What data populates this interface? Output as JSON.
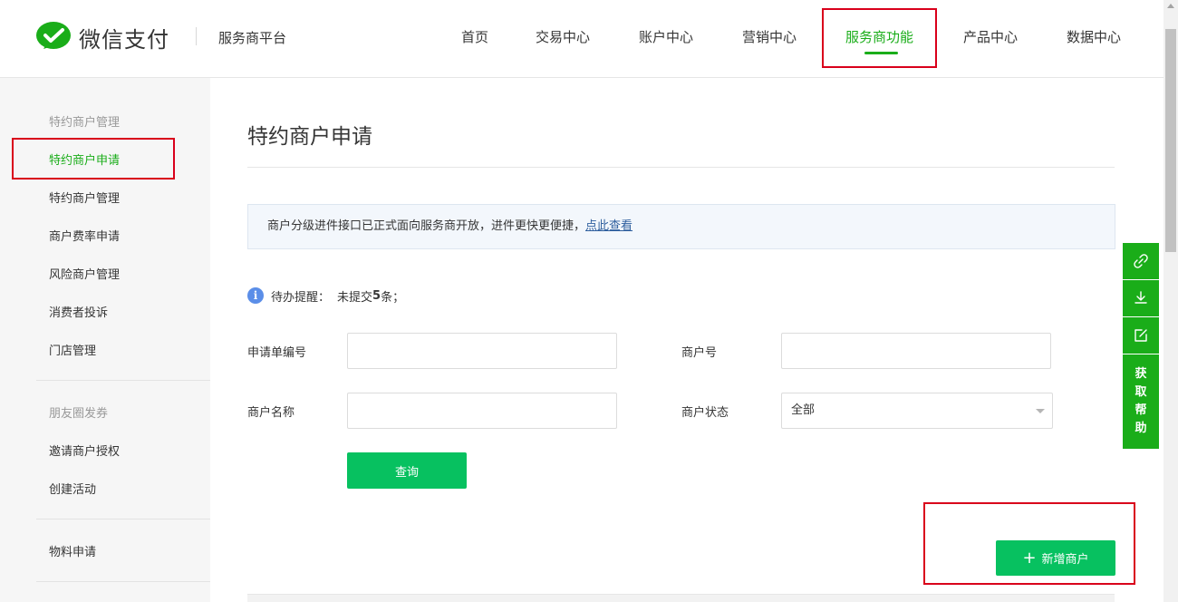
{
  "header": {
    "logo_text": "微信支付",
    "platform": "服务商平台",
    "nav": [
      {
        "label": "首页"
      },
      {
        "label": "交易中心"
      },
      {
        "label": "账户中心"
      },
      {
        "label": "营销中心"
      },
      {
        "label": "服务商功能",
        "active": true
      },
      {
        "label": "产品中心"
      },
      {
        "label": "数据中心"
      }
    ],
    "accent_color": "#1aad19"
  },
  "sidebar": {
    "groups": [
      {
        "title": "特约商户管理",
        "items": [
          "特约商户申请",
          "特约商户管理",
          "商户费率申请",
          "风险商户管理",
          "消费者投诉",
          "门店管理"
        ],
        "active_item": "特约商户申请"
      },
      {
        "title": "朋友圈发券",
        "items": [
          "邀请商户授权",
          "创建活动"
        ]
      },
      {
        "title": "",
        "items": [
          "物料申请"
        ]
      }
    ]
  },
  "main": {
    "title": "特约商户申请",
    "notice": {
      "text": "商户分级进件接口已正式面向服务商开放，进件更快更便捷，",
      "link": "点此查看"
    },
    "reminder": {
      "label": "待办提醒：",
      "prefix": "未提交",
      "count": "5",
      "suffix": "条；"
    },
    "form": {
      "order_no_label": "申请单编号",
      "order_no_value": "",
      "merchant_no_label": "商户号",
      "merchant_no_value": "",
      "merchant_name_label": "商户名称",
      "merchant_name_value": "",
      "merchant_status_label": "商户状态",
      "merchant_status_value": "全部",
      "query_button": "查询"
    },
    "add_button": "新增商户"
  },
  "float_tool": {
    "icons": [
      "link-icon",
      "download-icon",
      "edit-icon"
    ],
    "help_chars": [
      "获",
      "取",
      "帮",
      "助"
    ]
  }
}
